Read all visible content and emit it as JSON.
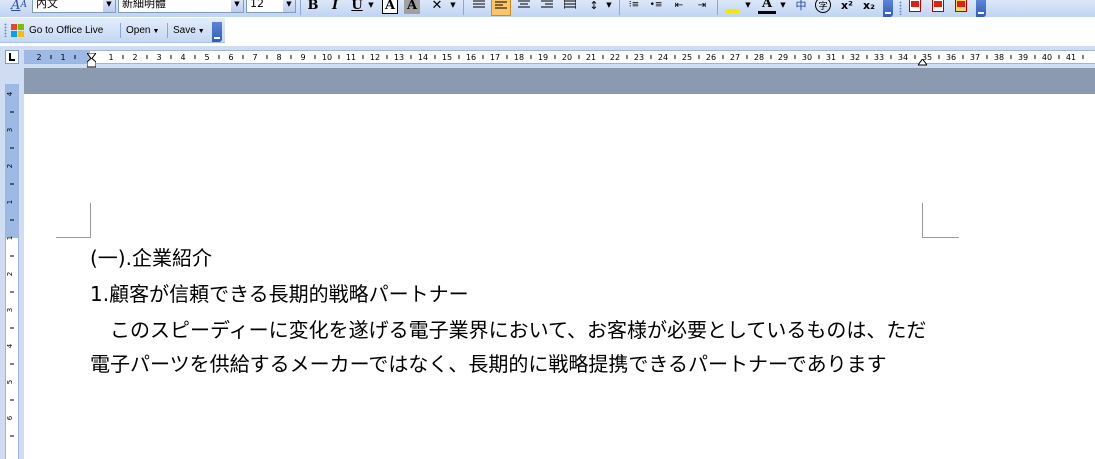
{
  "toolbar": {
    "style_value": "內文",
    "font_value": "新細明體",
    "size_value": "12",
    "bold_label": "B",
    "italic_label": "I",
    "underline_label": "U",
    "char_border_label": "A",
    "char_shading_label": "A",
    "font_color_label": "A",
    "phonetic_label": "中",
    "enclose_label": "字",
    "superscript_label": "x²",
    "subscript_label": "x₂"
  },
  "office_live": {
    "goto_label": "Go to Office Live",
    "open_label": "Open",
    "save_label": "Save"
  },
  "ruler": {
    "numbers": [
      "2",
      "1",
      "1",
      "2",
      "3",
      "4",
      "5",
      "6",
      "7",
      "8",
      "9",
      "10",
      "11",
      "12",
      "13",
      "14",
      "15",
      "16",
      "17",
      "18",
      "19",
      "20",
      "21",
      "22",
      "23",
      "24",
      "25",
      "26",
      "27",
      "28",
      "29",
      "30",
      "31",
      "32",
      "33",
      "34",
      "35",
      "36",
      "37",
      "38",
      "39",
      "40",
      "41"
    ],
    "vertical_numbers": [
      "4",
      "3",
      "2",
      "1",
      "1",
      "2",
      "3",
      "4",
      "5",
      "6"
    ]
  },
  "document": {
    "heading": "(一).企業紹介",
    "subheading": "1.顧客が信頼できる長期的戦略パートナー",
    "paragraph_line1": "　このスピーディーに変化を遂げる電子業界において、お客様が必要としているものは、ただ",
    "paragraph_line2": "電子パーツを供給するメーカーではなく、長期的に戦略提携できるパートナーであります"
  },
  "colors": {
    "toolbar_bg": "#c4d7f3",
    "ruler_margin": "#9db9e5",
    "doc_gray": "#8c9aaf",
    "page_bg": "#ffffff"
  }
}
